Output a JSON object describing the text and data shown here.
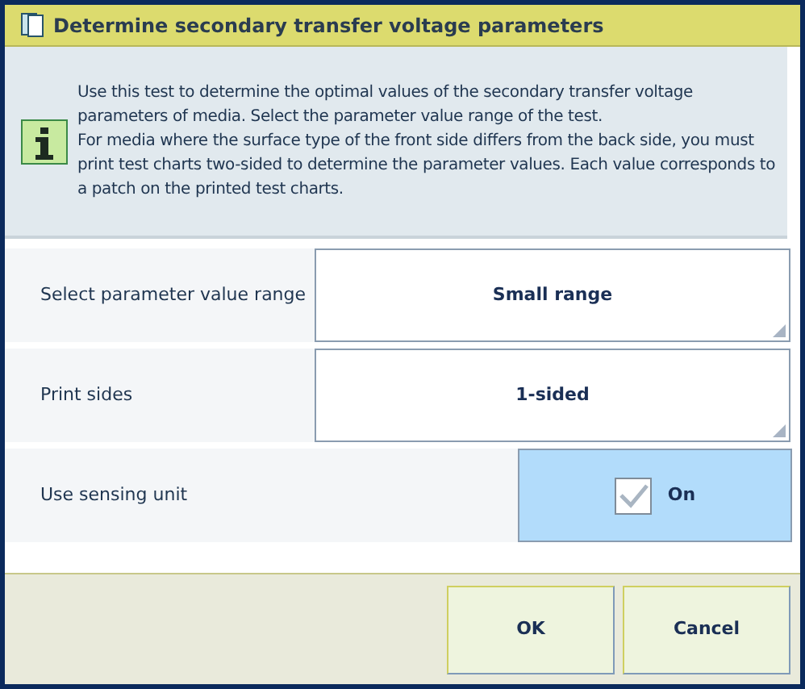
{
  "window": {
    "title": "Determine secondary transfer voltage parameters"
  },
  "info": {
    "lines": [
      "Use this test to determine the optimal values of the secondary transfer voltage parameters of media. Select the parameter value range of the test.",
      "For media where the surface type of the front side differs from the back side, you must print test charts two-sided to determine the parameter values. Each value corresponds to a patch on the printed test charts."
    ]
  },
  "settings": [
    {
      "kind": "dropdown",
      "label": "Select parameter value range",
      "value": "Small range"
    },
    {
      "kind": "dropdown",
      "label": "Print sides",
      "value": "1-sided"
    },
    {
      "kind": "toggle",
      "label": "Use sensing unit",
      "value": "On",
      "checked": true
    }
  ],
  "buttons": [
    "OK",
    "Cancel"
  ]
}
